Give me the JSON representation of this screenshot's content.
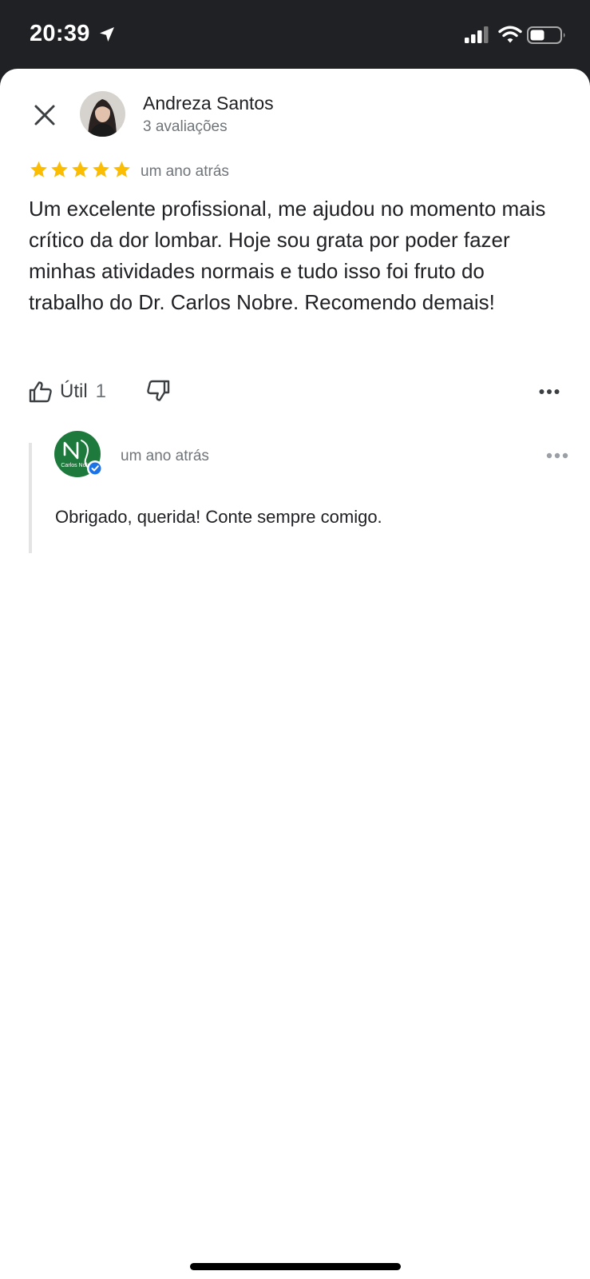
{
  "status_bar": {
    "time": "20:39",
    "icons": [
      "location-arrow-icon",
      "cellular-signal-icon",
      "wifi-icon",
      "battery-icon"
    ]
  },
  "review": {
    "reviewer_name": "Andreza Santos",
    "review_count": "3 avaliações",
    "rating": 5,
    "max_rating": 5,
    "time": "um ano atrás",
    "text": "Um excelente profissional, me ajudou no momento mais crítico da dor lombar. Hoje sou grata por poder fazer minhas atividades normais e tudo isso foi fruto do trabalho do Dr. Carlos Nobre. Recomendo demais!",
    "helpful_label": "Útil",
    "helpful_count": "1"
  },
  "reply": {
    "logo_text": "Carlos Nobre",
    "time": "um ano atrás",
    "text": "Obrigado, querida! Conte sempre comigo."
  },
  "colors": {
    "status_bar_bg": "#202124",
    "star": "#fbbc04",
    "verified_badge": "#1a73e8",
    "logo_green": "#1e7a3c",
    "secondary_text": "#70757a",
    "primary_text": "#202124"
  }
}
